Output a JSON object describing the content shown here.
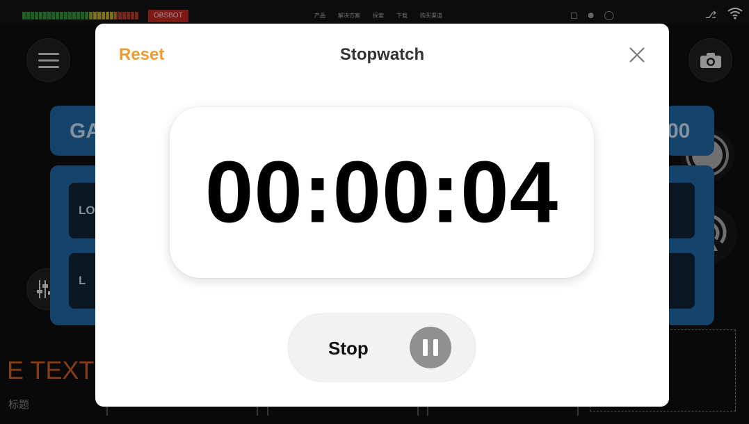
{
  "background": {
    "brand": "OBSBOT",
    "nav": [
      "产品",
      "解决方案",
      "探索",
      "下载",
      "购买渠道"
    ],
    "card_top_left": "GA",
    "card_top_right": "00",
    "card_row1": "LO",
    "card_row2": "L",
    "big_text": "E TEXT",
    "subtitle_cn": "标题",
    "icons": [
      "menu-icon",
      "camera-icon",
      "mixer-icon",
      "record-icon",
      "live-icon",
      "bag-icon",
      "user-icon",
      "globe-icon",
      "power-icon",
      "wifi-icon"
    ]
  },
  "modal": {
    "reset_label": "Reset",
    "title": "Stopwatch",
    "time": "00:00:04",
    "stop_label": "Stop",
    "close_icon": "close-icon",
    "pause_icon": "pause-icon",
    "accent": "#ee9b2f"
  }
}
